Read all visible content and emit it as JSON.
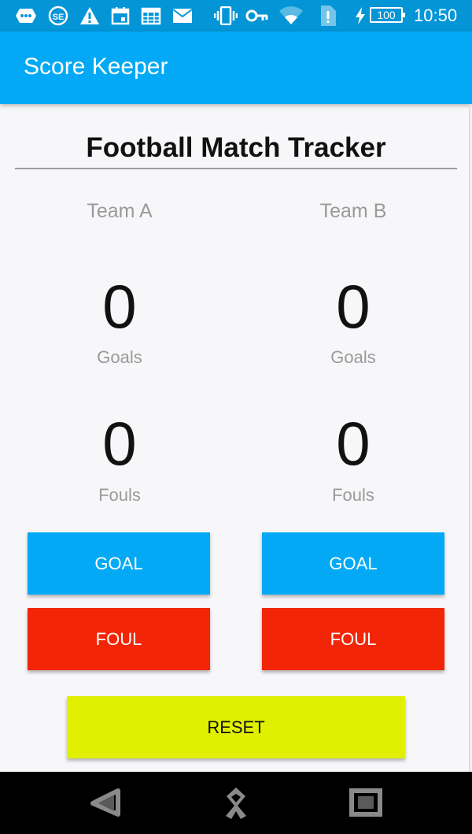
{
  "status_bar": {
    "icons": [
      "chat-icon",
      "sd-card-icon",
      "warning-icon",
      "calendar-icon",
      "calendar-grid-icon",
      "mail-icon",
      "vibrate-icon",
      "key-icon",
      "wifi-icon",
      "sim-alert-icon",
      "charging-icon"
    ],
    "battery": "100",
    "time": "10:50"
  },
  "app_bar": {
    "title": "Score Keeper"
  },
  "main": {
    "title": "Football Match Tracker",
    "team_a": {
      "name": "Team A",
      "goals": "0",
      "goals_label": "Goals",
      "fouls": "0",
      "fouls_label": "Fouls"
    },
    "team_b": {
      "name": "Team B",
      "goals": "0",
      "goals_label": "Goals",
      "fouls": "0",
      "fouls_label": "Fouls"
    },
    "buttons": {
      "goal": "GOAL",
      "foul": "FOUL",
      "reset": "RESET"
    }
  },
  "nav_bar": {
    "icons": [
      "back-icon",
      "home-icon",
      "recents-icon"
    ]
  },
  "colors": {
    "status_bar": "#0395d6",
    "app_bar": "#03a9f4",
    "goal_button": "#03a9f4",
    "foul_button": "#f22607",
    "reset_button": "#e0f000",
    "background": "#f7f6f8"
  }
}
